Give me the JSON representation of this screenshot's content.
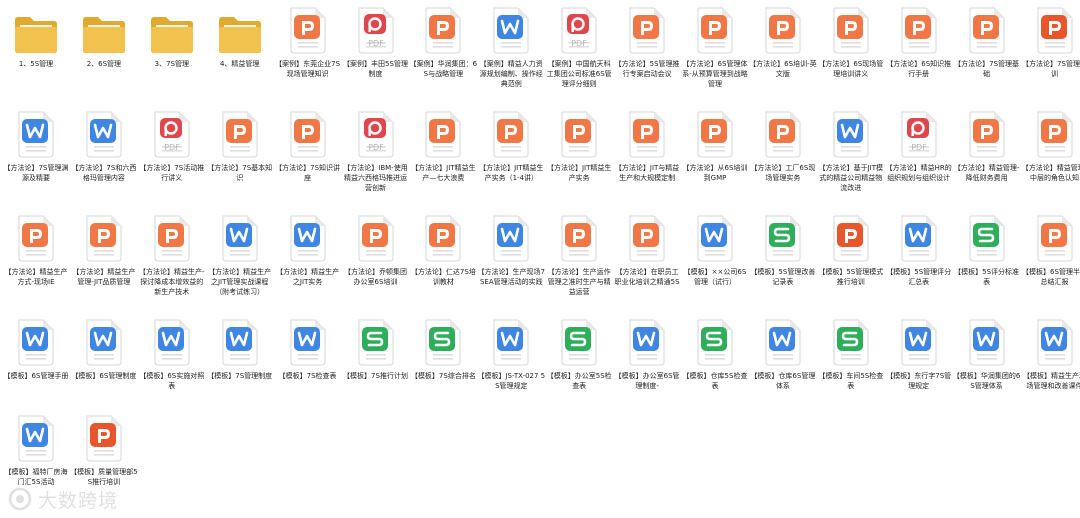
{
  "colors": {
    "folder": "#f2c24f",
    "ppt": "#f07847",
    "pdf": "#e0474c",
    "word": "#3f86e3",
    "excel": "#2dae5b",
    "text": "#222222"
  },
  "items": [
    {
      "type": "folder",
      "name": "1、5S管理"
    },
    {
      "type": "folder",
      "name": "2、6S管理"
    },
    {
      "type": "folder",
      "name": "3、7S管理"
    },
    {
      "type": "folder",
      "name": "4、精益管理"
    },
    {
      "type": "ppt",
      "name": "【案例】东莞企业7S现场管理知识"
    },
    {
      "type": "pdf",
      "name": "【案例】丰田5S管理制度"
    },
    {
      "type": "ppt",
      "name": "【案例】华润集团：6S与战略管理"
    },
    {
      "type": "word",
      "name": "【案例】精益人力资源规划编制、操作经典范例"
    },
    {
      "type": "pdf",
      "name": "【案例】中国航天科工集团公司标准6S管理评分细则"
    },
    {
      "type": "ppt",
      "name": "【方法论】5S管理推行专案启动会议"
    },
    {
      "type": "ppt",
      "name": "【方法论】6S管理体系-从预算管理到战略管理"
    },
    {
      "type": "ppt",
      "name": "【方法论】6S培训-英文版"
    },
    {
      "type": "ppt",
      "name": "【方法论】6S现场管理培训讲义"
    },
    {
      "type": "ppt",
      "name": "【方法论】6S知识推行手册"
    },
    {
      "type": "ppt",
      "name": "【方法论】7S管理基础"
    },
    {
      "type": "ppt",
      "name": "【方法论】7S管理培训",
      "dark": true
    },
    {
      "type": "word",
      "name": "【方法论】7S管理渊源及精要"
    },
    {
      "type": "word",
      "name": "【方法论】7S和六西格玛管理内容"
    },
    {
      "type": "pdf",
      "name": "【方法论】7S活动推行讲义"
    },
    {
      "type": "ppt",
      "name": "【方法论】7S基本知识"
    },
    {
      "type": "ppt",
      "name": "【方法论】7S知识讲座"
    },
    {
      "type": "pdf",
      "name": "【方法论】IBM-使用精益六西格玛推进运营创新"
    },
    {
      "type": "ppt",
      "name": "【方法论】JIT精益生产—七大浪费"
    },
    {
      "type": "ppt",
      "name": "【方法论】JIT精益生产实务（1-4讲）"
    },
    {
      "type": "ppt",
      "name": "【方法论】JIT精益生产实务"
    },
    {
      "type": "ppt",
      "name": "【方法论】JIT与精益生产和大规模定制"
    },
    {
      "type": "ppt",
      "name": "【方法论】从6S培训到GMP"
    },
    {
      "type": "ppt",
      "name": "【方法论】工厂6S现场管理实务"
    },
    {
      "type": "word",
      "name": "【方法论】基于JIT模式的精益公司精益物流改进"
    },
    {
      "type": "pdf",
      "name": "【方法论】精益HR的组织规划与组织设计"
    },
    {
      "type": "ppt",
      "name": "【方法论】精益管理-降低财务费用"
    },
    {
      "type": "ppt",
      "name": "【方法论】精益管理-中层的角色认知"
    },
    {
      "type": "ppt",
      "name": "【方法论】精益生产方式-现场IE"
    },
    {
      "type": "ppt",
      "name": "【方法论】精益生产管理-JIT品质管理"
    },
    {
      "type": "ppt",
      "name": "【方法论】精益生产-探讨降成本增效益的新生产技术"
    },
    {
      "type": "word",
      "name": "【方法论】精益生产之JIT管理实战课程（附考试练习）"
    },
    {
      "type": "word",
      "name": "【方法论】精益生产之JIT实务"
    },
    {
      "type": "ppt",
      "name": "【方法论】乔顿集团办公室6S培训"
    },
    {
      "type": "ppt",
      "name": "【方法论】仁达7S培训教材"
    },
    {
      "type": "word",
      "name": "【方法论】生产现场7SEA管理活动的实践"
    },
    {
      "type": "ppt",
      "name": "【方法论】生产运作管理之准时生产与精益运营"
    },
    {
      "type": "ppt",
      "name": "【方法论】在职员工职业化培训之精通5S"
    },
    {
      "type": "word",
      "name": "【模板】××公司6S管理（试行）"
    },
    {
      "type": "excel",
      "name": "【模板】5S管理改善记录表"
    },
    {
      "type": "ppt",
      "name": "【模板】5S管理模式推行培训",
      "dark": true
    },
    {
      "type": "word",
      "name": "【模板】5S管理评分汇总表"
    },
    {
      "type": "excel",
      "name": "【模板】5S评分标准表"
    },
    {
      "type": "ppt",
      "name": "【模板】6S管理半年总结汇报"
    },
    {
      "type": "word",
      "name": "【模板】6S管理手册"
    },
    {
      "type": "word",
      "name": "【模板】6S管理制度"
    },
    {
      "type": "word",
      "name": "【模板】6S实施对照表"
    },
    {
      "type": "word",
      "name": "【模板】7S管理制度"
    },
    {
      "type": "word",
      "name": "【模板】7S检查表"
    },
    {
      "type": "excel",
      "name": "【模板】7S推行计划"
    },
    {
      "type": "excel",
      "name": "【模板】7S综合排名"
    },
    {
      "type": "word",
      "name": "【模板】JS-TX-027 5S管理规定"
    },
    {
      "type": "excel",
      "name": "【模板】办公室5S检查表"
    },
    {
      "type": "word",
      "name": "【模板】办公室6S管理制度-"
    },
    {
      "type": "excel",
      "name": "【模板】仓库5S检查表"
    },
    {
      "type": "word",
      "name": "【模板】仓库6S管理体系"
    },
    {
      "type": "excel",
      "name": "【模板】车间5S检查表"
    },
    {
      "type": "word",
      "name": "【模板】东行字7S管理规定"
    },
    {
      "type": "word",
      "name": "【模板】华润集团的6S管理体系"
    },
    {
      "type": "word",
      "name": "【模板】精益生产现场管理和改善课件"
    },
    {
      "type": "word",
      "name": "【模板】福特厂房海门汇5S活动"
    },
    {
      "type": "ppt",
      "name": "【模板】质量管理部5S推行培训",
      "dark": true
    }
  ],
  "watermark": {
    "text": "大数跨境"
  }
}
